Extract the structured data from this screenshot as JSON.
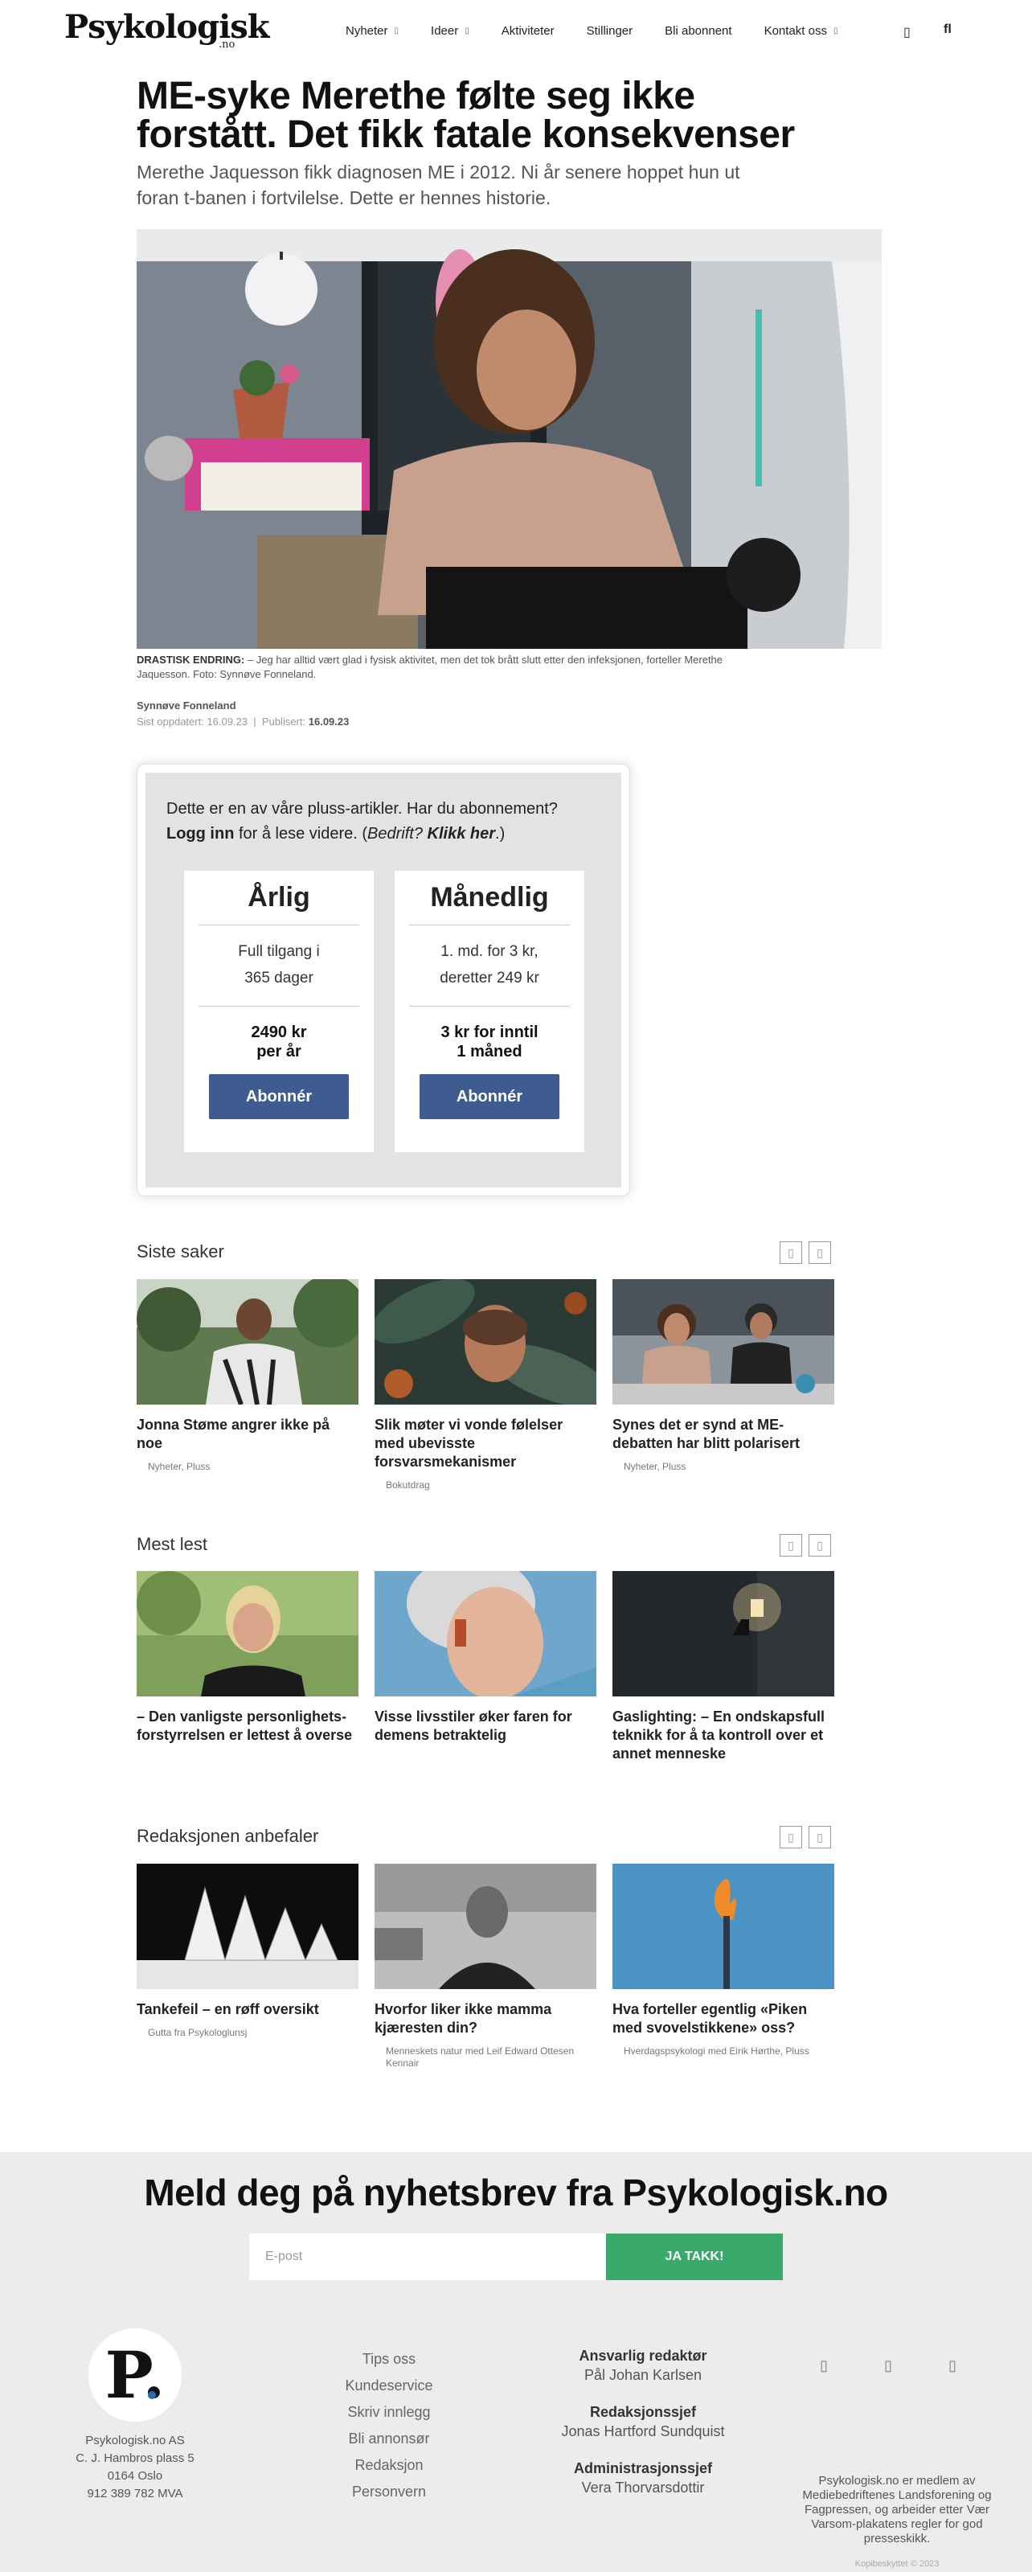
{
  "header": {
    "logo": "Psykologisk",
    "logo_suffix": ".no",
    "nav": [
      {
        "label": "Nyheter",
        "dropdown": true
      },
      {
        "label": "Ideer",
        "dropdown": true
      },
      {
        "label": "Aktiviteter",
        "dropdown": false
      },
      {
        "label": "Stillinger",
        "dropdown": false
      },
      {
        "label": "Bli abonnent",
        "dropdown": false
      },
      {
        "label": "Kontakt oss",
        "dropdown": true
      }
    ],
    "dropdown_glyph": "▯",
    "user_icon": "▯",
    "search_icon": "fl"
  },
  "article": {
    "title": "ME-syke Merethe følte seg ikke forstått. Det fikk fatale konsekvenser",
    "lead": "Merethe Jaquesson fikk diagnosen ME i 2012. Ni år senere hoppet hun ut foran t-banen i fortvilelse. Dette er hennes historie.",
    "caption_label": "DRASTISK ENDRING:",
    "caption_text": " – Jeg har alltid vært glad i fysisk aktivitet, men det tok brått slutt etter den infeksjonen, forteller Merethe Jaquesson. Foto: Synnøve Fonneland.",
    "author": "Synnøve Fonneland",
    "updated_label": "Sist oppdatert:",
    "updated": "16.09.23",
    "separator": "|",
    "published_label": "Publisert:",
    "published": "16.09.23"
  },
  "paywall": {
    "text_1": "Dette er en av våre pluss-artikler. Har du abonnement?",
    "login": "Logg inn",
    "text_2": " for å lese videre. (",
    "company": "Bedrift?",
    "click_here": "Klikk her",
    "text_3": ".)",
    "plans": [
      {
        "title": "Årlig",
        "desc_1": "Full tilgang i",
        "desc_2": "365 dager",
        "price_1": "2490 kr",
        "price_2": "per år",
        "button": "Abonnér"
      },
      {
        "title": "Månedlig",
        "desc_1": "1. md. for 3 kr,",
        "desc_2": "deretter 249 kr",
        "price_1": "3 kr for inntil",
        "price_2": "1 måned",
        "button": "Abonnér"
      }
    ]
  },
  "sections": [
    {
      "title": "Siste saker",
      "cards": [
        {
          "title": "Jonna Støme angrer ikke på noe",
          "tag": "Nyheter, Pluss"
        },
        {
          "title": "Slik møter vi vonde følelser med ubevisste forsvarsmekanismer",
          "tag": "Bokutdrag"
        },
        {
          "title": "Synes det er synd at ME-debatten har blitt polarisert",
          "tag": "Nyheter, Pluss"
        }
      ]
    },
    {
      "title": "Mest lest",
      "cards": [
        {
          "title": "– Den vanligste personlighets-forstyrrelsen er lettest å overse",
          "tag": ""
        },
        {
          "title": "Visse livsstiler øker faren for demens betraktelig",
          "tag": ""
        },
        {
          "title": "Gaslighting: – En ondskapsfull teknikk for å ta kontroll over et annet menneske",
          "tag": ""
        }
      ]
    },
    {
      "title": "Redaksjonen anbefaler",
      "cards": [
        {
          "title": "Tankefeil – en røff oversikt",
          "tag": "Gutta fra Psykologlunsj"
        },
        {
          "title": "Hvorfor liker ikke mamma kjæresten din?",
          "tag": "Menneskets natur med Leif Edward Ottesen Kennair"
        },
        {
          "title": "Hva forteller egentlig «Piken med svovelstikkene» oss?",
          "tag": "Hverdagspsykologi med Eirik Hørthe, Pluss"
        }
      ]
    }
  ],
  "carousel": {
    "prev_glyph": "▯",
    "next_glyph": "▯"
  },
  "newsletter": {
    "title": "Meld deg på nyhetsbrev fra Psykologisk.no",
    "placeholder": "E-post",
    "button": "JA TAKK!"
  },
  "footer": {
    "logo_letter": "P.",
    "address": [
      "Psykologisk.no AS",
      "C. J. Hambros plass 5",
      "0164 Oslo",
      "912 389 782 MVA"
    ],
    "links": [
      "Tips oss",
      "Kundeservice",
      "Skriv innlegg",
      "Bli annonsør",
      "Redaksjon",
      "Personvern"
    ],
    "editors": [
      {
        "role": "Ansvarlig redaktør",
        "name": "Pål Johan Karlsen"
      },
      {
        "role": "Redaksjonssjef",
        "name": "Jonas Hartford Sundquist"
      },
      {
        "role": "Administrasjonssjef",
        "name": "Vera Thorvarsdottir"
      }
    ],
    "social_icons": [
      "▯",
      "▯",
      "▯"
    ],
    "membership": "Psykologisk.no er medlem av Mediebedriftenes Landsforening og Fagpressen, og arbeider etter Vær Varsom-plakatens regler for god presseskikk.",
    "copyright": "Kopibeskyttet © 2023"
  },
  "colors": {
    "accent": "#3e5c8f",
    "newsletter_button": "#3aaa6a",
    "paywall_bg": "#e3e3e3",
    "footer_bg": "#ececec"
  }
}
